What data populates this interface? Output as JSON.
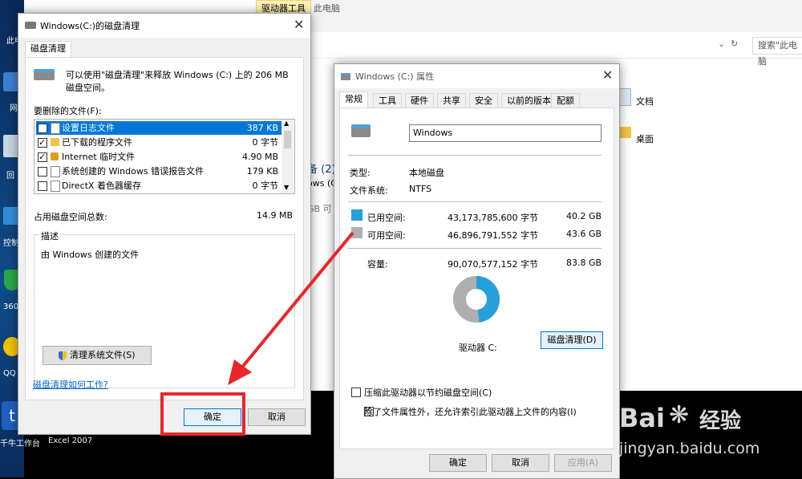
{
  "desktop": {
    "icons": [
      {
        "label": "此电",
        "glyph": "▣"
      },
      {
        "label": "网",
        "glyph": "◉"
      },
      {
        "label": "回",
        "glyph": "♻"
      },
      {
        "label": "控制",
        "glyph": "⚙"
      },
      {
        "label": "360",
        "glyph": "⛨"
      },
      {
        "label": "QQ",
        "glyph": "●"
      },
      {
        "label": "千牛工作台",
        "glyph": "t"
      },
      {
        "label": "Excel 2007",
        "glyph": ""
      }
    ]
  },
  "explorer": {
    "ribbon_tab": "驱动器工具",
    "ribbon_title": "此电脑",
    "search_placeholder": "搜索\"此电脑",
    "items": [
      {
        "label": "文档"
      },
      {
        "label": "桌面"
      }
    ],
    "section": "备 (2)",
    "drive_fragment": "ows (C",
    "drive_size_fragment": "GB 可"
  },
  "cleanup": {
    "title": "Windows(C:)的磁盘清理",
    "tab": "磁盘清理",
    "intro": "可以使用\"磁盘清理\"来释放 Windows (C:) 上的 206 MB 磁盘空间。",
    "list_label": "要删除的文件(F):",
    "files": [
      {
        "name": "设置日志文件",
        "size": "387 KB",
        "checked": false,
        "selected": true
      },
      {
        "name": "已下载的程序文件",
        "size": "0 字节",
        "checked": true,
        "selected": false
      },
      {
        "name": "Internet 临时文件",
        "size": "4.90 MB",
        "checked": true,
        "selected": false
      },
      {
        "name": "系统创建的 Windows 错误报告文件",
        "size": "179 KB",
        "checked": false,
        "selected": false
      },
      {
        "name": "DirectX 着色器缓存",
        "size": "0 字节",
        "checked": false,
        "selected": false
      }
    ],
    "total_label": "占用磁盘空间总数:",
    "total_value": "14.9 MB",
    "desc_title": "描述",
    "desc_text": "由 Windows 创建的文件",
    "clean_sys_btn": "清理系统文件(S)",
    "link": "磁盘清理如何工作?",
    "ok": "确定",
    "cancel": "取消"
  },
  "props": {
    "title": "Windows (C:) 属性",
    "tabs": [
      "常规",
      "工具",
      "硬件",
      "共享",
      "安全",
      "以前的版本",
      "配额"
    ],
    "name_value": "Windows",
    "type_label": "类型:",
    "type_value": "本地磁盘",
    "fs_label": "文件系统:",
    "fs_value": "NTFS",
    "used_label": "已用空间:",
    "used_bytes": "43,173,785,600 字节",
    "used_gb": "40.2 GB",
    "free_label": "可用空间:",
    "free_bytes": "46,896,791,552 字节",
    "free_gb": "43.6 GB",
    "cap_label": "容量:",
    "cap_bytes": "90,070,577,152 字节",
    "cap_gb": "83.8 GB",
    "used_fraction": 0.479,
    "used_color": "#26a0da",
    "free_color": "#aeaeae",
    "drive_label": "驱动器 C:",
    "cleanup_btn": "磁盘清理(D)",
    "compress_label": "压缩此驱动器以节约磁盘空间(C)",
    "compress_checked": false,
    "index_label": "除了文件属性外，还允许索引此驱动器上文件的内容(I)",
    "index_checked": true,
    "ok": "确定",
    "cancel": "取消",
    "apply": "应用(A)"
  },
  "watermark": {
    "brand": "Bai",
    "brand2": "经验",
    "url": "jingyan.baidu.com"
  },
  "annotation_color": "#e8262b"
}
